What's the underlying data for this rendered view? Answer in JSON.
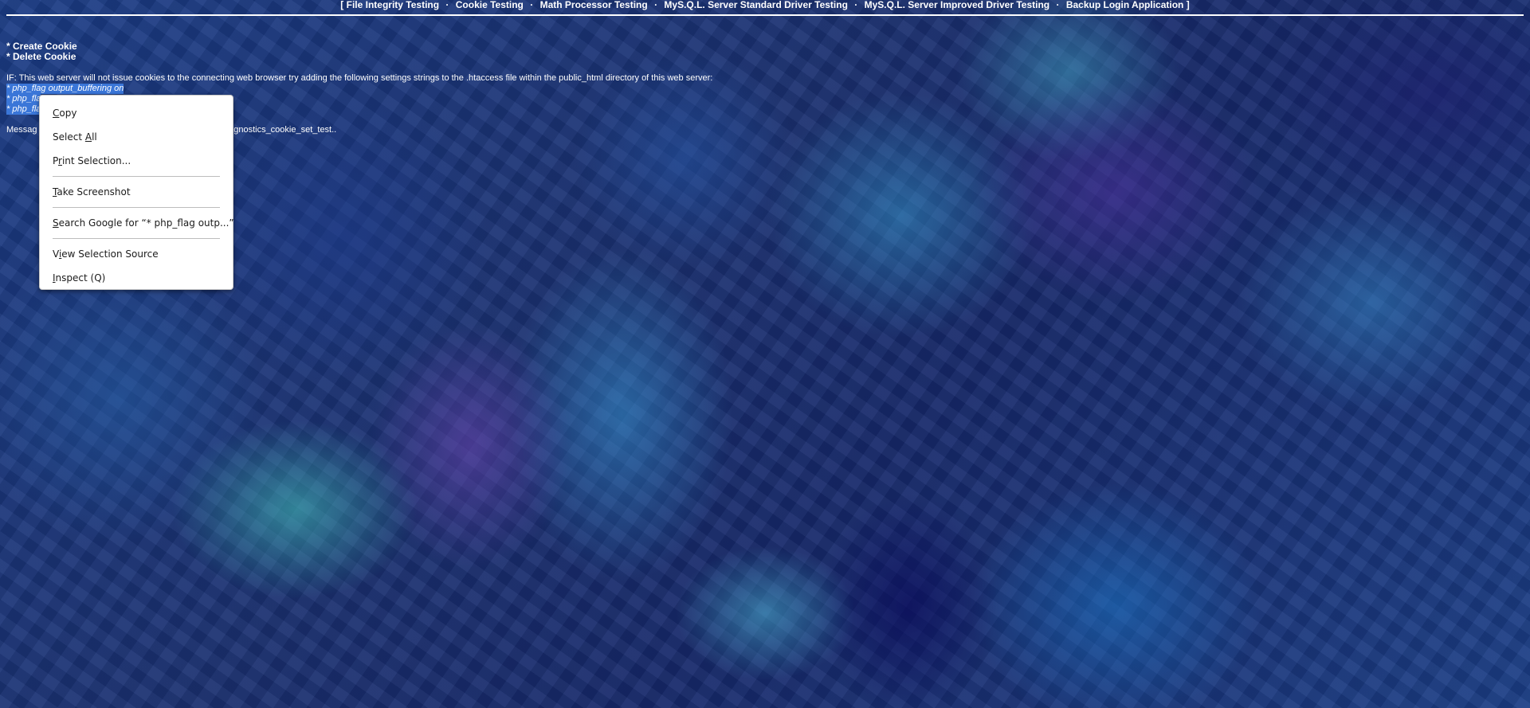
{
  "nav": {
    "open_bracket": "[",
    "close_bracket": "]",
    "separator": "·",
    "links": [
      "File Integrity Testing",
      "Cookie Testing",
      "Math Processor Testing",
      "MyS.Q.L. Server Standard Driver Testing",
      "MyS.Q.L. Server Improved Driver Testing",
      "Backup Login Application"
    ]
  },
  "actions": {
    "create_cookie": "* Create Cookie",
    "delete_cookie": "* Delete Cookie"
  },
  "note": "IF: This web server will not issue cookies to the connecting web browser try adding the following settings strings to the .htaccess file within the public_html directory of this web server:",
  "settings": {
    "line1": "* php_flag output_buffering on",
    "line2": "* php_fla",
    "line3": "* php_fla"
  },
  "message": {
    "start": "Messag",
    "end": "diagnostics_cookie_set_test.."
  },
  "context_menu": {
    "copy": {
      "accel": "C",
      "rest": "opy"
    },
    "select_all": {
      "pre": "Select ",
      "accel": "A",
      "rest": "ll"
    },
    "print_selection": {
      "pre": "P",
      "accel": "r",
      "rest": "int Selection..."
    },
    "take_screenshot": {
      "accel": "T",
      "rest": "ake Screenshot"
    },
    "search_google": {
      "accel": "S",
      "rest": "earch Google for “* php_flag outp...”"
    },
    "view_selection_source": {
      "pre": "V",
      "accel": "i",
      "rest": "ew Selection Source"
    },
    "inspect": {
      "accel": "I",
      "rest": "nspect (Q)"
    }
  }
}
